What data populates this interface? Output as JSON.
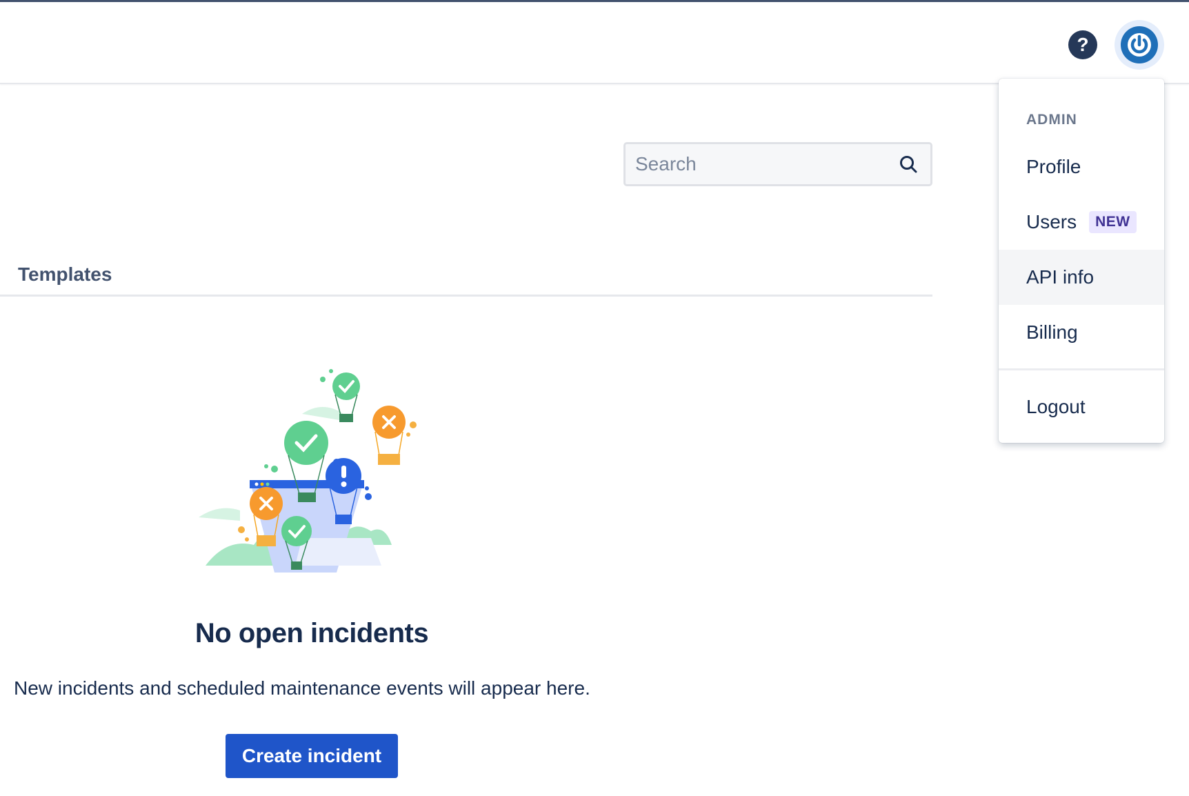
{
  "header": {
    "help_icon": "question-mark-icon",
    "avatar_icon": "power-icon",
    "avatar_color": "#1f6fb8"
  },
  "search": {
    "placeholder": "Search",
    "icon": "search-icon"
  },
  "tabs": {
    "templates_label": "Templates"
  },
  "empty_state": {
    "illustration": "hot-air-balloons-illustration",
    "title": "No open incidents",
    "description": "New incidents and scheduled maintenance events will appear here.",
    "create_button": "Create incident",
    "button_color": "#1f55c9"
  },
  "user_menu": {
    "heading": "ADMIN",
    "items": [
      {
        "label": "Profile",
        "badge": ""
      },
      {
        "label": "Users",
        "badge": "NEW"
      },
      {
        "label": "API info",
        "badge": ""
      },
      {
        "label": "Billing",
        "badge": ""
      }
    ],
    "logout_label": "Logout",
    "highlighted_item": "API info"
  }
}
